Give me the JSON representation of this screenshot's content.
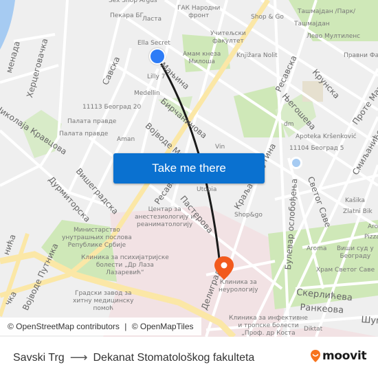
{
  "map": {
    "street_labels": [
      {
        "name": "menada",
        "text": "менада"
      },
      {
        "name": "hercegovacka",
        "text": "Херцеговачка"
      },
      {
        "name": "savska",
        "text": "Савска"
      },
      {
        "name": "nikolaja-kravcova",
        "text": "Николаја Кравцова"
      },
      {
        "name": "visegradska",
        "text": "Вишеградска"
      },
      {
        "name": "durmitorska",
        "text": "Дурмиторска"
      },
      {
        "name": "vojvode-milenka",
        "text": "Војводе Миленка"
      },
      {
        "name": "resavska-1",
        "text": "Ресавска"
      },
      {
        "name": "resavska-2",
        "text": "Ресавска"
      },
      {
        "name": "manjina",
        "text": "Мањина"
      },
      {
        "name": "bircaninova",
        "text": "Бирчанинова"
      },
      {
        "name": "pasterova",
        "text": "Пастерова"
      },
      {
        "name": "kralja-milutina",
        "text": "Краља Милутина"
      },
      {
        "name": "krunska",
        "text": "Крунска"
      },
      {
        "name": "njegoseva",
        "text": "Његошева"
      },
      {
        "name": "prote-mateje",
        "text": "Проте Матеје"
      },
      {
        "name": "smiljaniceva",
        "text": "Смиљанићева"
      },
      {
        "name": "svetog-save",
        "text": "Светог Саве"
      },
      {
        "name": "bulevar-oslobodjenja",
        "text": "Булевар ослобођења"
      },
      {
        "name": "deligradska",
        "text": "Делиградска"
      },
      {
        "name": "vojvode-putnika",
        "text": "Војводе Путника"
      },
      {
        "name": "skerliceva",
        "text": "Скерлићева"
      },
      {
        "name": "rankeova",
        "text": "Ранкеова"
      },
      {
        "name": "sumatovacka",
        "text": "Шум"
      },
      {
        "name": "nj-street",
        "text": "нића"
      },
      {
        "name": "cka-street",
        "text": "чка"
      }
    ],
    "poi_labels": [
      {
        "name": "sex-shop-argus",
        "text": "Sex Shop Argus"
      },
      {
        "name": "pekara-bg",
        "text": "Пекара БГ"
      },
      {
        "name": "lasta",
        "text": "Ласта"
      },
      {
        "name": "gak",
        "text": "ГАК Народни\nфронт"
      },
      {
        "name": "shop-and-go-1",
        "text": "Shop & Go"
      },
      {
        "name": "tasmajdan-park",
        "text": "Ташмајдан /Парк/"
      },
      {
        "name": "tasmajdan",
        "text": "Ташмајдан"
      },
      {
        "name": "levo",
        "text": "Лево"
      },
      {
        "name": "multilens",
        "text": "Мултиленс"
      },
      {
        "name": "uciteljski",
        "text": "Учитељски\nфакултет"
      },
      {
        "name": "ella-secret",
        "text": "Ella Secret"
      },
      {
        "name": "amam",
        "text": "Амам кнеза\nМилоша"
      },
      {
        "name": "knjizara-nolit",
        "text": "Knjižara Nolit"
      },
      {
        "name": "pravni-fakultet",
        "text": "Правни Фак"
      },
      {
        "name": "lilly",
        "text": "Lilly 7"
      },
      {
        "name": "medellin",
        "text": "Medellin"
      },
      {
        "name": "beograd-20",
        "text": "11113 Београд 20"
      },
      {
        "name": "palata-pravde-1",
        "text": "Палата правде"
      },
      {
        "name": "palata-pravde-2",
        "text": "Палата правде"
      },
      {
        "name": "aman",
        "text": "Aman"
      },
      {
        "name": "vin",
        "text": "Vin"
      },
      {
        "name": "dm",
        "text": "dm"
      },
      {
        "name": "apoteka",
        "text": "Apoteka Kršenković"
      },
      {
        "name": "beograd-5",
        "text": "11104 Београд 5"
      },
      {
        "name": "utopia",
        "text": "Utopia"
      },
      {
        "name": "shop-and-go-2",
        "text": "Shop&go"
      },
      {
        "name": "centar-anest",
        "text": "Центар за\nанестезиологију и\nреаниматологију"
      },
      {
        "name": "kasika",
        "text": "Kašika"
      },
      {
        "name": "zlatni-bik",
        "text": "Zlatni Bik"
      },
      {
        "name": "aroma-1",
        "text": "Aroma"
      },
      {
        "name": "pizza",
        "text": "Pizza"
      },
      {
        "name": "aroma-2",
        "text": "Aroma"
      },
      {
        "name": "visi-sud",
        "text": "Виши суд у\nБеограду"
      },
      {
        "name": "hram",
        "text": "Храм Светог Саве"
      },
      {
        "name": "ministarstvo",
        "text": "Министарство\nунутрашњих послова\nРепублике Србије"
      },
      {
        "name": "klinika-psih",
        "text": "Клиника за психијатријске\nболести „Др Лаза\nЛазаревић“"
      },
      {
        "name": "klinika-neuro",
        "text": "Клиника за\nнеурологију"
      },
      {
        "name": "gradski-zavod",
        "text": "Градски завод за\nхитну медицинску\nпомоћ"
      },
      {
        "name": "klinika-infekt",
        "text": "Клиника за инфективне\nи тропске болести\n„Проф. др Коста"
      },
      {
        "name": "diktat",
        "text": "Diktat"
      }
    ],
    "attribution": {
      "osm": "© OpenStreetMap contributors",
      "separator": "|",
      "omt": "© OpenMapTiles"
    },
    "cta_label": "Take me there"
  },
  "footer": {
    "origin": "Savski Trg",
    "arrow": "⟶",
    "destination": "Dekanat Stomatološkog fakulteta",
    "brand": "moovit"
  },
  "colors": {
    "route": "#1a1a1a",
    "origin_marker": "#2e7cf6",
    "destination_marker": "#f25a1d",
    "cta": "#0a71d0",
    "park": "#cfe8b8",
    "hospital": "#f0dde0",
    "major_road": "#fbe7a6",
    "water": "#a6cbf2"
  }
}
